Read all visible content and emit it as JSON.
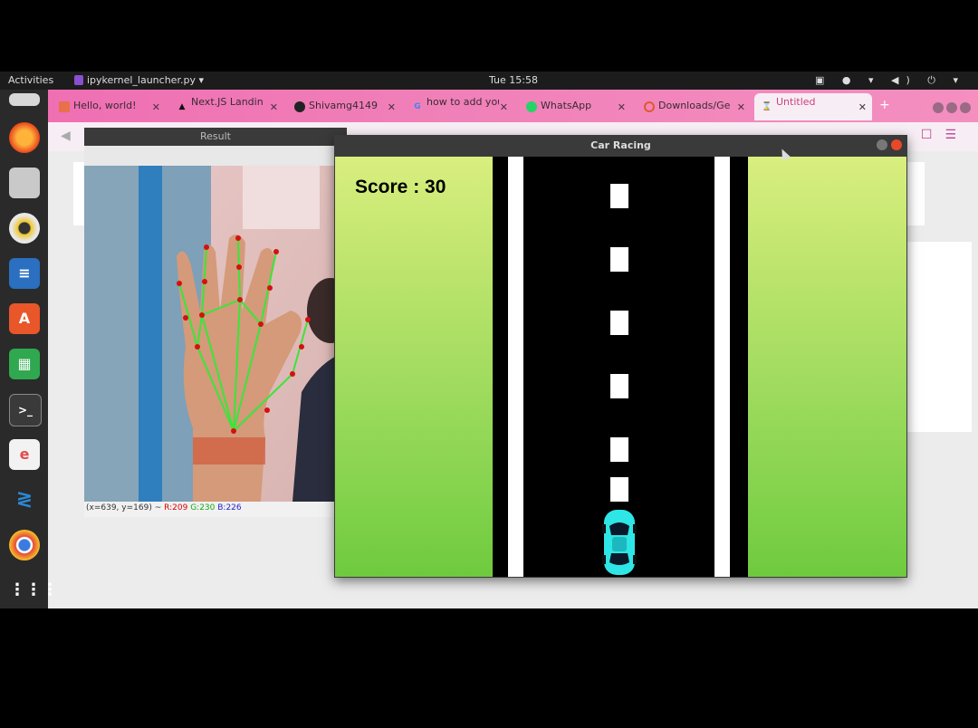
{
  "topbar": {
    "activities": "Activities",
    "app_name": "ipykernel_launcher.py ▾",
    "clock": "Tue 15:58",
    "tray": "▣ ● ▾ ◀) ⏻ ▾"
  },
  "browser": {
    "tabs": [
      {
        "label": "Hello, world!",
        "icon": "app-icon",
        "icon_color": "#e8704a"
      },
      {
        "label": "Next.JS Landing",
        "icon": "triangle-icon",
        "icon_color": "#111111"
      },
      {
        "label": "Shivamg4149",
        "icon": "github-icon",
        "icon_color": "#222222"
      },
      {
        "label": "how to add you",
        "icon": "google-icon",
        "icon_color": "#4285f4"
      },
      {
        "label": "WhatsApp",
        "icon": "whatsapp-icon",
        "icon_color": "#25d366"
      },
      {
        "label": "Downloads/Ge",
        "icon": "circle-icon",
        "icon_color": "#e05a2a"
      },
      {
        "label": "Untitled",
        "icon": "hourglass-icon",
        "icon_color": "#f0a030"
      }
    ],
    "new_tab": "+"
  },
  "result_window": {
    "title": "Result",
    "status_prefix": "(x=639, y=169) ~",
    "status_r": "R:209",
    "status_g": "G:230",
    "status_b": "B:226"
  },
  "racing_window": {
    "title": "Car Racing",
    "score_text": "Score : 30",
    "car_color": "#2ee6e6",
    "road_color": "#000000",
    "grass_top": "#d9ee7e",
    "grass_bottom": "#6fca3e"
  },
  "dock": [
    {
      "name": "files-icon",
      "color": "#d8d8d8"
    },
    {
      "name": "firefox-icon",
      "color": "#ff7a1a"
    },
    {
      "name": "file-cabinet-icon",
      "color": "#bdbdbd"
    },
    {
      "name": "rhythmbox-icon",
      "color": "#f0c830"
    },
    {
      "name": "writer-icon",
      "color": "#2a6fc0"
    },
    {
      "name": "software-center-icon",
      "color": "#e8562a"
    },
    {
      "name": "calc-icon",
      "color": "#2fa84f"
    },
    {
      "name": "terminal-icon",
      "color": "#3a3a3a"
    },
    {
      "name": "eclipse-icon",
      "color": "#e24a4a"
    },
    {
      "name": "vscode-icon",
      "color": "#2a8ad8"
    },
    {
      "name": "chrome-icon",
      "color": "#e64a3a"
    },
    {
      "name": "app-grid-icon",
      "color": "#2a2a2a"
    }
  ]
}
